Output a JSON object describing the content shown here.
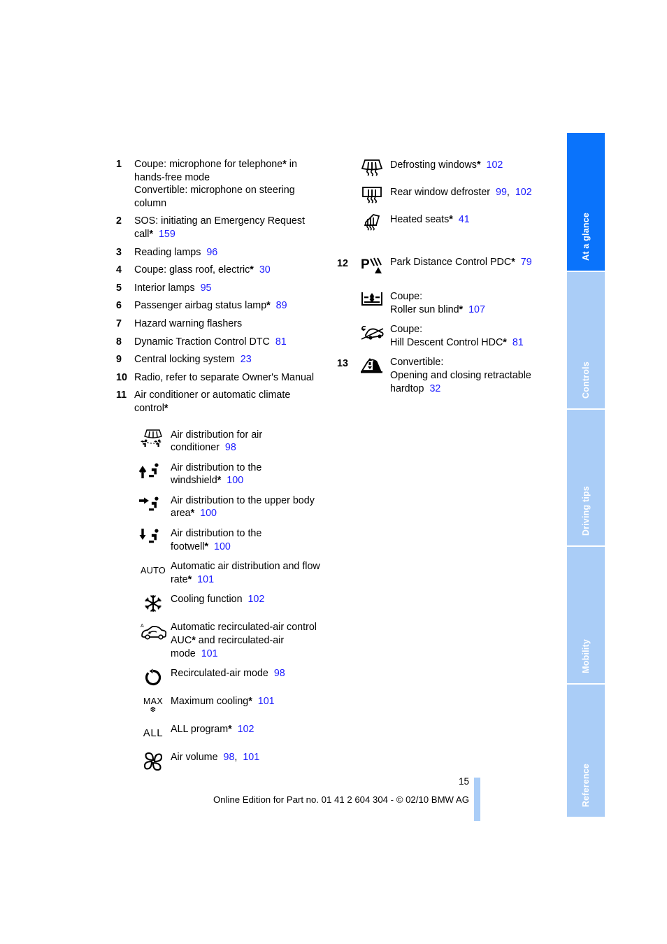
{
  "document": {
    "page_number": "15",
    "footer_text": "Online Edition for Part no. 01 41 2 604 304 - © 02/10 BMW AG"
  },
  "tabs": [
    {
      "label": "At a glance",
      "active": true
    },
    {
      "label": "Controls",
      "active": false
    },
    {
      "label": "Driving tips",
      "active": false
    },
    {
      "label": "Mobility",
      "active": false
    },
    {
      "label": "Reference",
      "active": false
    }
  ],
  "colors": {
    "tab_active": "#0a73fb",
    "tab_inactive": "#aacdf7",
    "page_reference": "#1b1bff",
    "text": "#000000"
  },
  "left_column": {
    "numbered_items": [
      {
        "number": "1",
        "lines": [
          {
            "text": "Coupe: microphone for telephone",
            "star": true,
            "tail": " in"
          },
          {
            "text": "hands-free mode"
          },
          {
            "text": "Convertible: microphone on steering"
          },
          {
            "text": "column"
          }
        ]
      },
      {
        "number": "2",
        "lines": [
          {
            "text": "SOS: initiating an Emergency Request"
          },
          {
            "text": "call",
            "star": true,
            "ref": "159"
          }
        ]
      },
      {
        "number": "3",
        "lines": [
          {
            "text": "Reading lamps",
            "ref": "96"
          }
        ]
      },
      {
        "number": "4",
        "lines": [
          {
            "text": "Coupe: glass roof, electric",
            "star": true,
            "ref": "30"
          }
        ]
      },
      {
        "number": "5",
        "lines": [
          {
            "text": "Interior lamps",
            "ref": "95"
          }
        ]
      },
      {
        "number": "6",
        "lines": [
          {
            "text": "Passenger airbag status lamp",
            "star": true,
            "ref": "89"
          }
        ]
      },
      {
        "number": "7",
        "lines": [
          {
            "text": "Hazard warning flashers"
          }
        ]
      },
      {
        "number": "8",
        "lines": [
          {
            "text": "Dynamic Traction Control DTC",
            "ref": "81"
          }
        ]
      },
      {
        "number": "9",
        "lines": [
          {
            "text": "Central locking system",
            "ref": "23"
          }
        ]
      },
      {
        "number": "10",
        "lines": [
          {
            "text": "Radio, refer to separate Owner's Manual"
          }
        ]
      },
      {
        "number": "11",
        "lines": [
          {
            "text": "Air conditioner or automatic climate"
          },
          {
            "text": "control",
            "star": true
          }
        ]
      }
    ],
    "climate_icons": [
      {
        "icon": "air-distribution-ac-icon",
        "lines": [
          {
            "text": "Air distribution for air"
          },
          {
            "text": "conditioner",
            "ref": "98"
          }
        ]
      },
      {
        "icon": "air-distribution-windshield-icon",
        "lines": [
          {
            "text": "Air distribution to the"
          },
          {
            "text": "windshield",
            "star": true,
            "ref": "100"
          }
        ]
      },
      {
        "icon": "air-distribution-upper-body-icon",
        "lines": [
          {
            "text": "Air distribution to the upper body"
          },
          {
            "text": "area",
            "star": true,
            "ref": "100"
          }
        ]
      },
      {
        "icon": "air-distribution-footwell-icon",
        "lines": [
          {
            "text": "Air distribution to the"
          },
          {
            "text": "footwell",
            "star": true,
            "ref": "100"
          }
        ]
      },
      {
        "icon": "auto-text-icon",
        "icon_text": "AUTO",
        "lines": [
          {
            "text": "Automatic air distribution and flow"
          },
          {
            "text": "rate",
            "star": true,
            "ref": "101"
          }
        ]
      },
      {
        "icon": "snowflake-cooling-icon",
        "lines": [
          {
            "text": "Cooling function",
            "ref": "102"
          }
        ]
      },
      {
        "icon": "auc-recirculation-car-icon",
        "lines": [
          {
            "text": "Automatic recirculated-air control"
          },
          {
            "text": "AUC",
            "star": true,
            "tail": " and recirculated-air"
          },
          {
            "text": "mode",
            "ref": "101"
          }
        ]
      },
      {
        "icon": "recirculated-air-loop-icon",
        "lines": [
          {
            "text": "Recirculated-air mode",
            "ref": "98"
          }
        ]
      },
      {
        "icon": "max-cooling-icon",
        "icon_text": "MAX",
        "lines": [
          {
            "text": "Maximum cooling",
            "star": true,
            "ref": "101"
          }
        ]
      },
      {
        "icon": "all-program-text-icon",
        "icon_text": "ALL",
        "lines": [
          {
            "text": "ALL program",
            "star": true,
            "ref": "102"
          }
        ]
      },
      {
        "icon": "fan-air-volume-icon",
        "lines": [
          {
            "text": "Air volume",
            "ref": "98",
            "ref2": "101"
          }
        ]
      }
    ]
  },
  "right_column": {
    "climate_icons": [
      {
        "icon": "defrosting-windows-icon",
        "lines": [
          {
            "text": "Defrosting windows",
            "star": true,
            "ref": "102"
          }
        ]
      },
      {
        "icon": "rear-window-defroster-icon",
        "lines": [
          {
            "text": "Rear window defroster",
            "ref": "99",
            "ref2": "102"
          }
        ]
      },
      {
        "icon": "heated-seats-icon",
        "lines": [
          {
            "text": "Heated seats",
            "star": true,
            "ref": "41"
          }
        ]
      }
    ],
    "numbered_items": [
      {
        "number": "12",
        "icon": "park-distance-control-icon",
        "lines": [
          {
            "text": "Park Distance Control PDC",
            "star": true,
            "ref": "79"
          }
        ]
      },
      {
        "number": "",
        "icon": "roller-sun-blind-icon",
        "lines": [
          {
            "text": "Coupe:"
          },
          {
            "text": "Roller sun blind",
            "star": true,
            "ref": "107"
          }
        ]
      },
      {
        "number": "",
        "icon": "hill-descent-control-icon",
        "lines": [
          {
            "text": "Coupe:"
          },
          {
            "text": "Hill Descent Control HDC",
            "star": true,
            "ref": "81"
          }
        ]
      },
      {
        "number": "13",
        "icon": "retractable-hardtop-icon",
        "lines": [
          {
            "text": "Convertible:"
          },
          {
            "text": "Opening and closing retractable"
          },
          {
            "text": "hardtop",
            "ref": "32"
          }
        ]
      }
    ]
  }
}
